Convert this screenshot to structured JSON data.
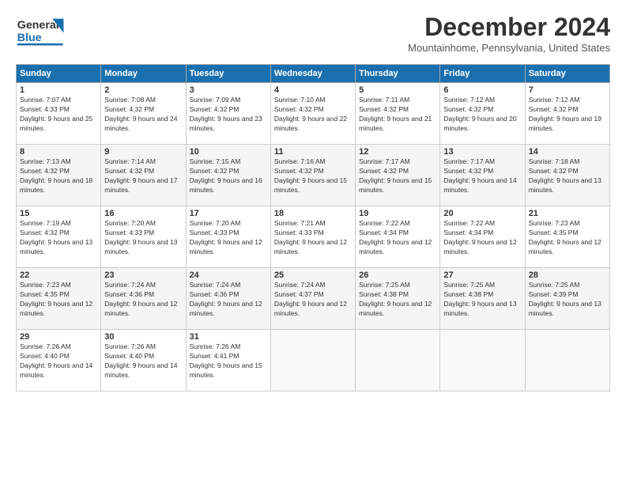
{
  "header": {
    "logo_line1": "General",
    "logo_line2": "Blue",
    "title": "December 2024",
    "subtitle": "Mountainhome, Pennsylvania, United States"
  },
  "calendar": {
    "days_of_week": [
      "Sunday",
      "Monday",
      "Tuesday",
      "Wednesday",
      "Thursday",
      "Friday",
      "Saturday"
    ],
    "weeks": [
      [
        {
          "day": "1",
          "sunrise": "7:07 AM",
          "sunset": "4:33 PM",
          "daylight": "9 hours and 25 minutes."
        },
        {
          "day": "2",
          "sunrise": "7:08 AM",
          "sunset": "4:32 PM",
          "daylight": "9 hours and 24 minutes."
        },
        {
          "day": "3",
          "sunrise": "7:09 AM",
          "sunset": "4:32 PM",
          "daylight": "9 hours and 23 minutes."
        },
        {
          "day": "4",
          "sunrise": "7:10 AM",
          "sunset": "4:32 PM",
          "daylight": "9 hours and 22 minutes."
        },
        {
          "day": "5",
          "sunrise": "7:11 AM",
          "sunset": "4:32 PM",
          "daylight": "9 hours and 21 minutes."
        },
        {
          "day": "6",
          "sunrise": "7:12 AM",
          "sunset": "4:32 PM",
          "daylight": "9 hours and 20 minutes."
        },
        {
          "day": "7",
          "sunrise": "7:12 AM",
          "sunset": "4:32 PM",
          "daylight": "9 hours and 19 minutes."
        }
      ],
      [
        {
          "day": "8",
          "sunrise": "7:13 AM",
          "sunset": "4:32 PM",
          "daylight": "9 hours and 18 minutes."
        },
        {
          "day": "9",
          "sunrise": "7:14 AM",
          "sunset": "4:32 PM",
          "daylight": "9 hours and 17 minutes."
        },
        {
          "day": "10",
          "sunrise": "7:15 AM",
          "sunset": "4:32 PM",
          "daylight": "9 hours and 16 minutes."
        },
        {
          "day": "11",
          "sunrise": "7:16 AM",
          "sunset": "4:32 PM",
          "daylight": "9 hours and 15 minutes."
        },
        {
          "day": "12",
          "sunrise": "7:17 AM",
          "sunset": "4:32 PM",
          "daylight": "9 hours and 15 minutes."
        },
        {
          "day": "13",
          "sunrise": "7:17 AM",
          "sunset": "4:32 PM",
          "daylight": "9 hours and 14 minutes."
        },
        {
          "day": "14",
          "sunrise": "7:18 AM",
          "sunset": "4:32 PM",
          "daylight": "9 hours and 13 minutes."
        }
      ],
      [
        {
          "day": "15",
          "sunrise": "7:19 AM",
          "sunset": "4:32 PM",
          "daylight": "9 hours and 13 minutes."
        },
        {
          "day": "16",
          "sunrise": "7:20 AM",
          "sunset": "4:33 PM",
          "daylight": "9 hours and 13 minutes."
        },
        {
          "day": "17",
          "sunrise": "7:20 AM",
          "sunset": "4:33 PM",
          "daylight": "9 hours and 12 minutes."
        },
        {
          "day": "18",
          "sunrise": "7:21 AM",
          "sunset": "4:33 PM",
          "daylight": "9 hours and 12 minutes."
        },
        {
          "day": "19",
          "sunrise": "7:22 AM",
          "sunset": "4:34 PM",
          "daylight": "9 hours and 12 minutes."
        },
        {
          "day": "20",
          "sunrise": "7:22 AM",
          "sunset": "4:34 PM",
          "daylight": "9 hours and 12 minutes."
        },
        {
          "day": "21",
          "sunrise": "7:23 AM",
          "sunset": "4:35 PM",
          "daylight": "9 hours and 12 minutes."
        }
      ],
      [
        {
          "day": "22",
          "sunrise": "7:23 AM",
          "sunset": "4:35 PM",
          "daylight": "9 hours and 12 minutes."
        },
        {
          "day": "23",
          "sunrise": "7:24 AM",
          "sunset": "4:36 PM",
          "daylight": "9 hours and 12 minutes."
        },
        {
          "day": "24",
          "sunrise": "7:24 AM",
          "sunset": "4:36 PM",
          "daylight": "9 hours and 12 minutes."
        },
        {
          "day": "25",
          "sunrise": "7:24 AM",
          "sunset": "4:37 PM",
          "daylight": "9 hours and 12 minutes."
        },
        {
          "day": "26",
          "sunrise": "7:25 AM",
          "sunset": "4:38 PM",
          "daylight": "9 hours and 12 minutes."
        },
        {
          "day": "27",
          "sunrise": "7:25 AM",
          "sunset": "4:38 PM",
          "daylight": "9 hours and 13 minutes."
        },
        {
          "day": "28",
          "sunrise": "7:25 AM",
          "sunset": "4:39 PM",
          "daylight": "9 hours and 13 minutes."
        }
      ],
      [
        {
          "day": "29",
          "sunrise": "7:26 AM",
          "sunset": "4:40 PM",
          "daylight": "9 hours and 14 minutes."
        },
        {
          "day": "30",
          "sunrise": "7:26 AM",
          "sunset": "4:40 PM",
          "daylight": "9 hours and 14 minutes."
        },
        {
          "day": "31",
          "sunrise": "7:26 AM",
          "sunset": "4:41 PM",
          "daylight": "9 hours and 15 minutes."
        },
        null,
        null,
        null,
        null
      ]
    ]
  }
}
